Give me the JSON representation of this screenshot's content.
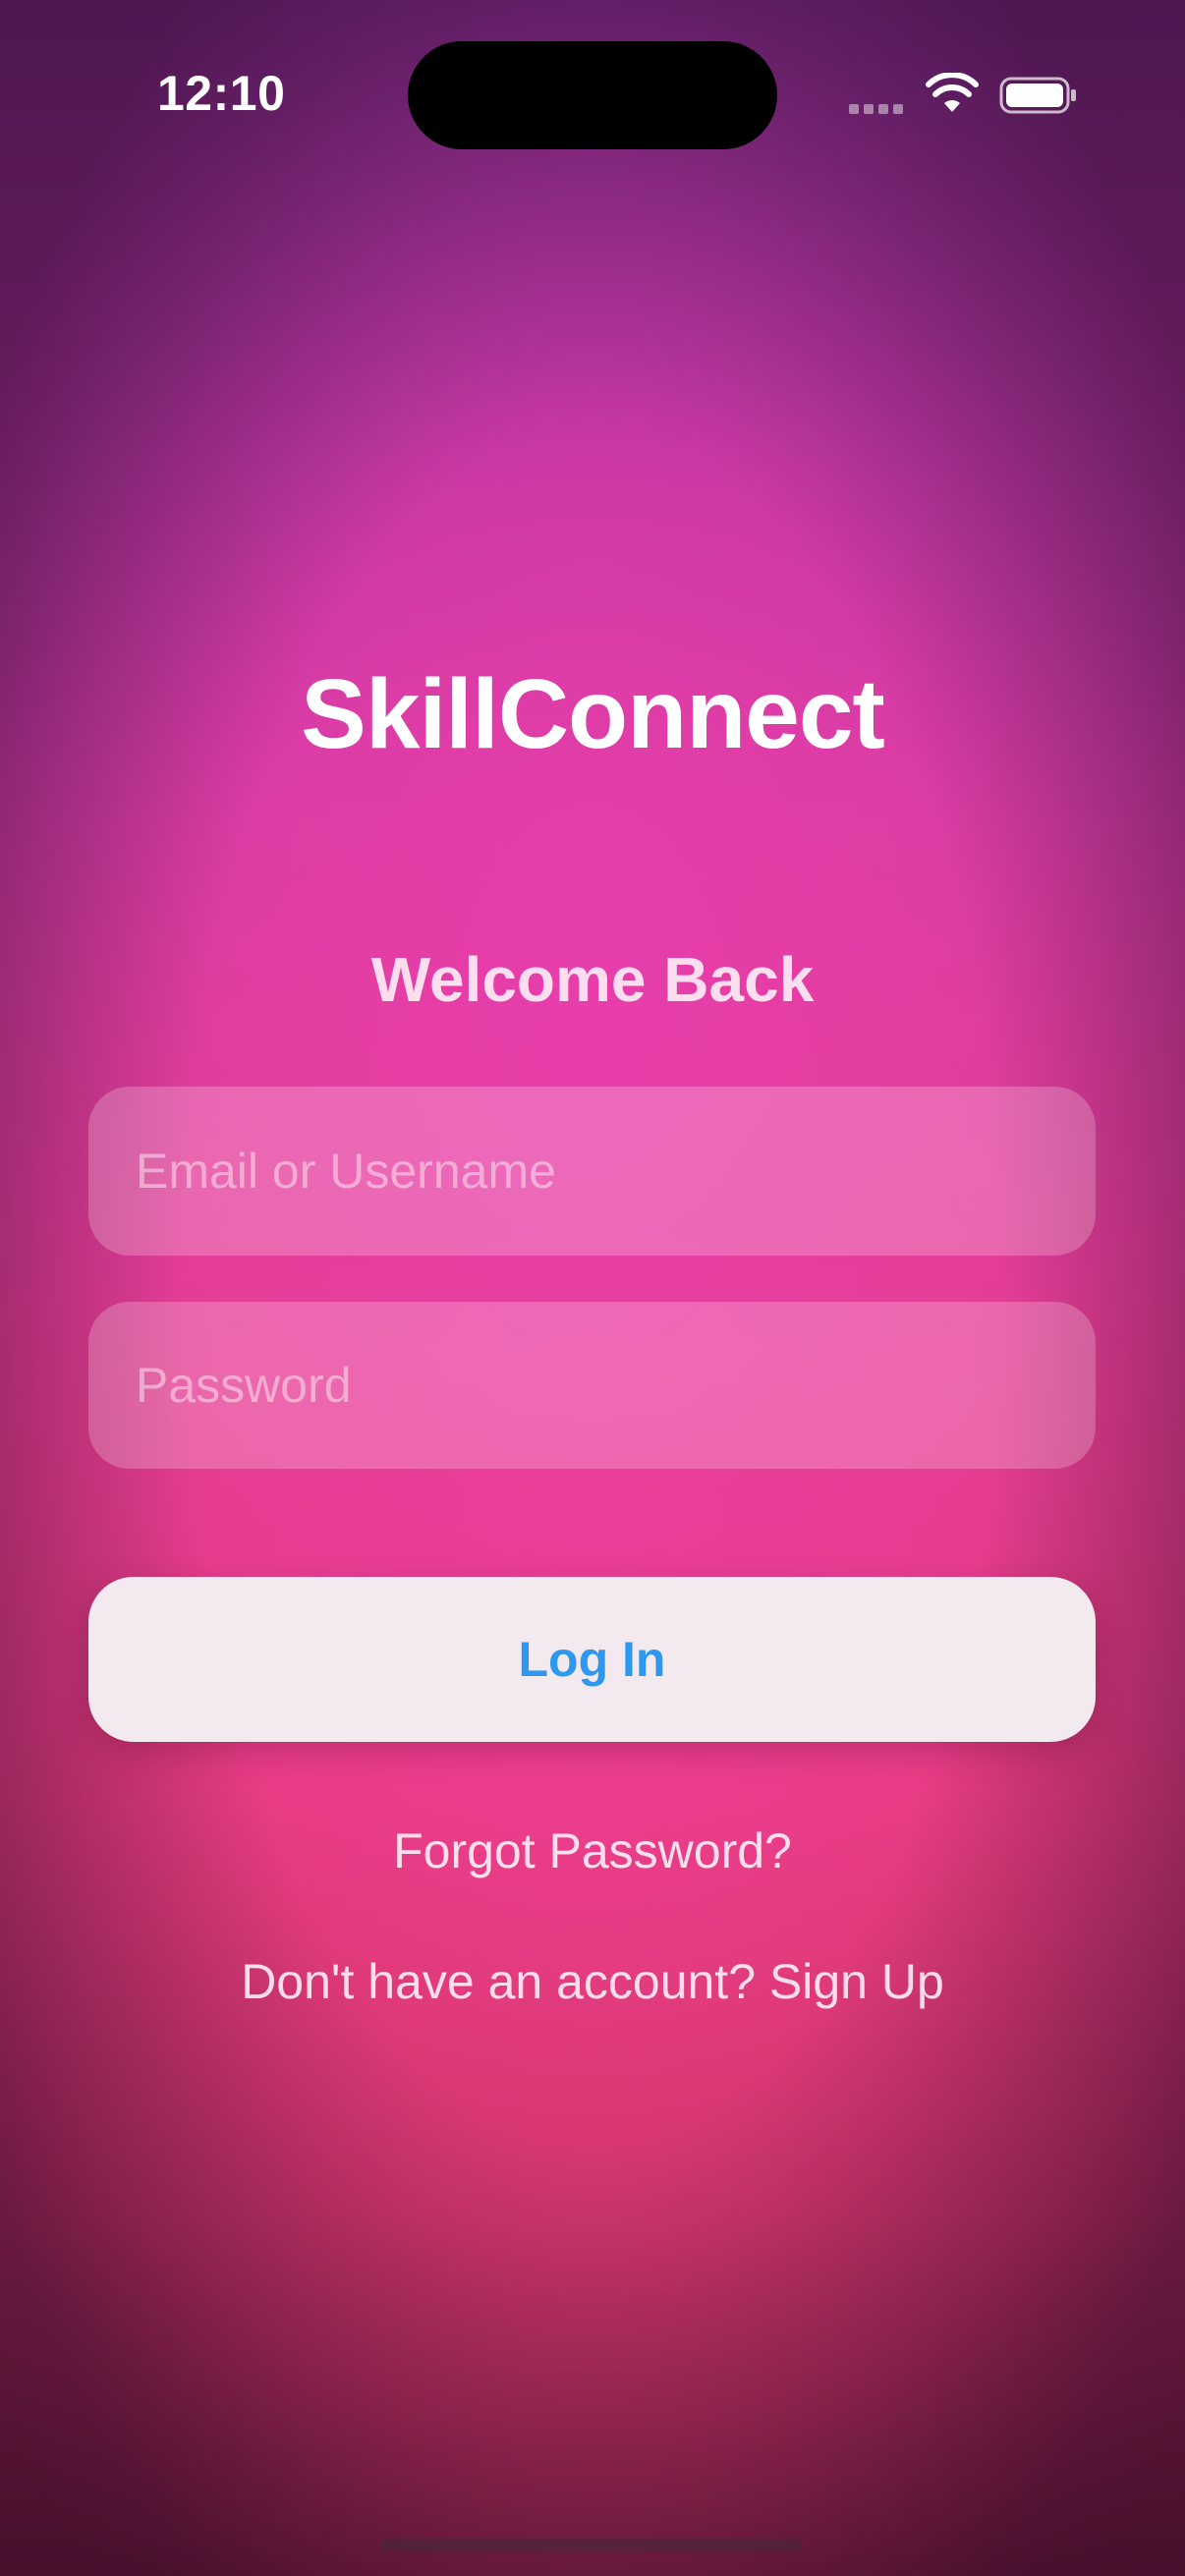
{
  "status_bar": {
    "time": "12:10"
  },
  "app": {
    "title": "SkillConnect",
    "subtitle": "Welcome Back"
  },
  "form": {
    "email_placeholder": "Email or Username",
    "email_value": "",
    "password_placeholder": "Password",
    "password_value": "",
    "login_label": "Log In"
  },
  "links": {
    "forgot_password": "Forgot Password?",
    "signup": "Don't have an account? Sign Up"
  },
  "colors": {
    "accent": "#2e98ef",
    "gradient_top": "#7e2a86",
    "gradient_mid": "#de3c93",
    "gradient_bottom": "#6b1a33"
  },
  "icons": {
    "signal": "cellular-signal-icon",
    "wifi": "wifi-icon",
    "battery": "battery-icon"
  }
}
